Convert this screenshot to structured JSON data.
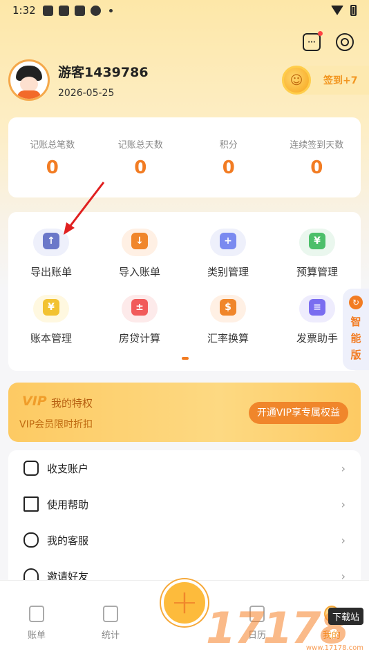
{
  "status_bar": {
    "time": "1:32"
  },
  "profile": {
    "username": "游客1439786",
    "date": "2026-05-25"
  },
  "signin": {
    "label": "签到+7"
  },
  "stats": [
    {
      "label": "记账总笔数",
      "value": "0"
    },
    {
      "label": "记账总天数",
      "value": "0"
    },
    {
      "label": "积分",
      "value": "0"
    },
    {
      "label": "连续签到天数",
      "value": "0"
    }
  ],
  "tools": [
    {
      "label": "导出账单",
      "icon": "export-icon",
      "color": "#6b78c9",
      "bg": "#eef0fb",
      "glyph": "↑"
    },
    {
      "label": "导入账单",
      "icon": "import-icon",
      "color": "#f0862b",
      "bg": "#fff0e4",
      "glyph": "↓"
    },
    {
      "label": "类别管理",
      "icon": "category-icon",
      "color": "#7a8af0",
      "bg": "#eef0fb",
      "glyph": "+"
    },
    {
      "label": "预算管理",
      "icon": "budget-icon",
      "color": "#4cbf6a",
      "bg": "#eaf7ee",
      "glyph": "¥"
    },
    {
      "label": "账本管理",
      "icon": "ledger-icon",
      "color": "#f2c232",
      "bg": "#fff8e0",
      "glyph": "¥"
    },
    {
      "label": "房贷计算",
      "icon": "calculator-icon",
      "color": "#f15a5a",
      "bg": "#fdeaea",
      "glyph": "±"
    },
    {
      "label": "汇率换算",
      "icon": "exchange-icon",
      "color": "#f0862b",
      "bg": "#fff0e4",
      "glyph": "$"
    },
    {
      "label": "发票助手",
      "icon": "invoice-icon",
      "color": "#7a6df0",
      "bg": "#eeecfd",
      "glyph": "≡"
    }
  ],
  "side_tab": {
    "text": "智能版"
  },
  "vip": {
    "logo": "VIP",
    "title": "我的特权",
    "subtitle": "VIP会员限时折扣",
    "button": "开通VIP享专属权益"
  },
  "menu": [
    {
      "label": "收支账户",
      "icon": "wallet-icon"
    },
    {
      "label": "使用帮助",
      "icon": "book-icon"
    },
    {
      "label": "我的客服",
      "icon": "chat-icon"
    },
    {
      "label": "邀请好友",
      "icon": "person-icon"
    }
  ],
  "tabbar": {
    "items": [
      {
        "label": "账单"
      },
      {
        "label": "统计"
      },
      {
        "label": "日历"
      },
      {
        "label": "我的"
      }
    ],
    "fab": "+"
  },
  "watermark": {
    "digits": "17178",
    "tag": "下载站",
    "url": "www.17178.com"
  },
  "colors": {
    "accent": "#f27c23",
    "vip_button": "#f0862b"
  }
}
